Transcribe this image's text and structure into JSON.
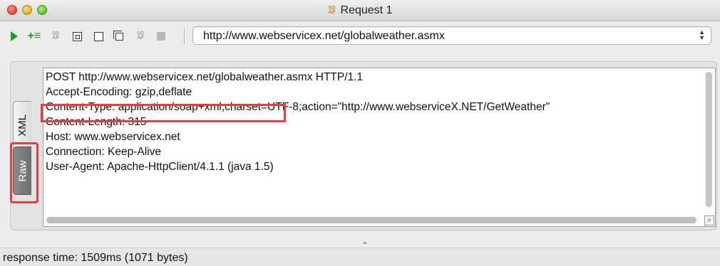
{
  "window": {
    "title": "Request 1",
    "title_icon": "soap-icon"
  },
  "toolbar": {
    "buttons": [
      {
        "name": "submit-request",
        "icon": "play-icon"
      },
      {
        "name": "add-header",
        "icon": "add-lines-icon"
      },
      {
        "name": "soap-action",
        "icon": "soap-icon"
      },
      {
        "name": "validate",
        "icon": "square-dot-icon"
      },
      {
        "name": "maximize",
        "icon": "square-icon"
      },
      {
        "name": "clone",
        "icon": "copy-icon"
      },
      {
        "name": "soap-ops",
        "icon": "soap-icon"
      },
      {
        "name": "stop",
        "icon": "stop-icon"
      }
    ],
    "endpoint": "http://www.webservicex.net/globalweather.asmx"
  },
  "editor": {
    "tabs": [
      "XML",
      "Raw"
    ],
    "active_tab": "Raw",
    "lines": [
      "POST http://www.webservicex.net/globalweather.asmx HTTP/1.1",
      "Accept-Encoding: gzip,deflate",
      "Content-Type: application/soap+xml;charset=UTF-8;action=\"http://www.webserviceX.NET/GetWeather\"",
      "Content-Length: 315",
      "Host: www.webservicex.net",
      "Connection: Keep-Alive",
      "User-Agent: Apache-HttpClient/4.1.1 (java 1.5)"
    ]
  },
  "status": {
    "text": "response time: 1509ms (1071 bytes)"
  },
  "colors": {
    "highlight": "#e53e3e",
    "play": "#1aa31a",
    "soap_icon": "#c8860f"
  }
}
